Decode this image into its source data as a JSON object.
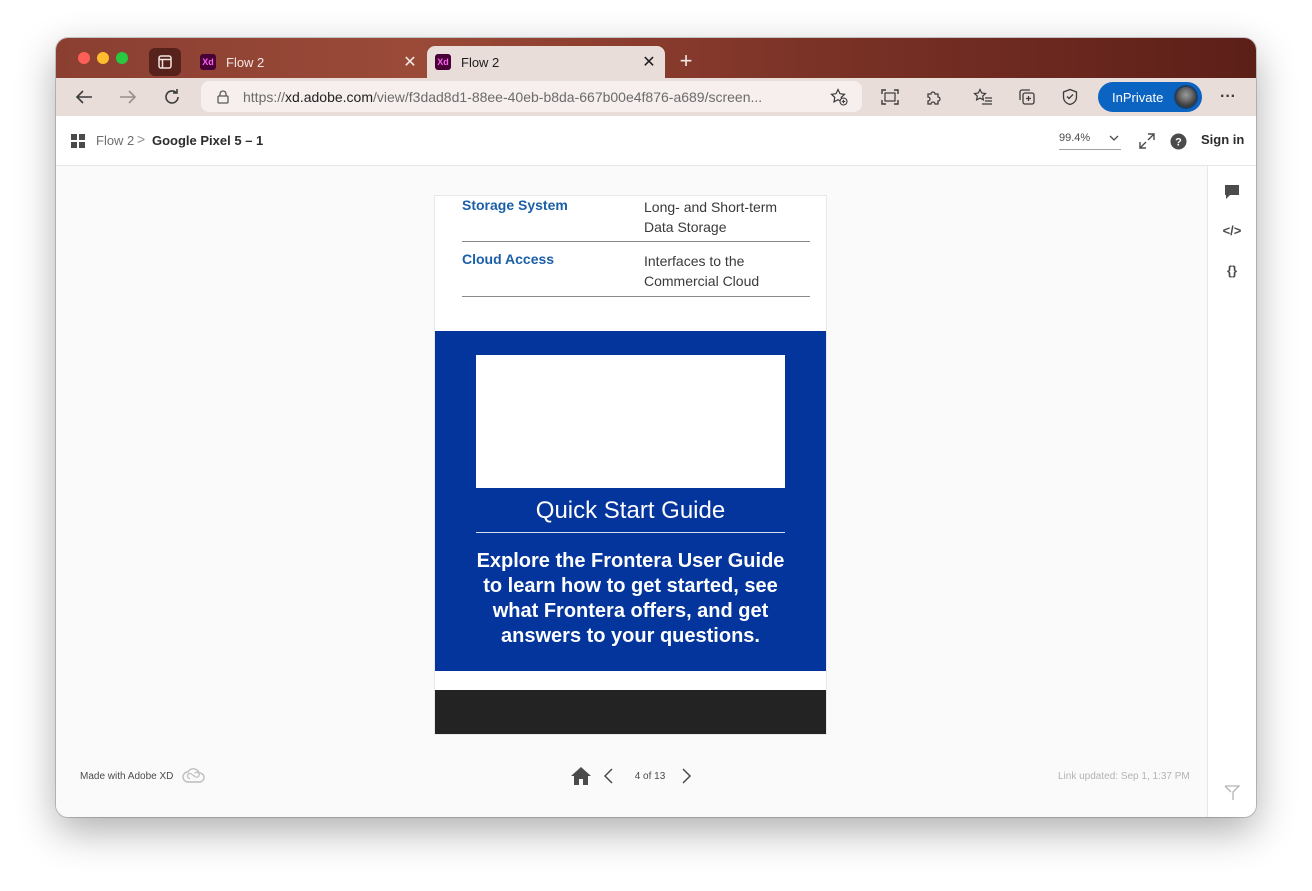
{
  "browser": {
    "tabs": [
      {
        "title": "Flow 2",
        "icon": "adobe-xd-icon",
        "active": false
      },
      {
        "title": "Flow 2",
        "icon": "adobe-xd-icon",
        "active": true
      }
    ],
    "url_prefix": "https://",
    "url_domain": "xd.adobe.com",
    "url_path": "/view/f3dad8d1-88ee-40eb-b8da-667b00e4f876-a689/screen...",
    "inprivate_label": "InPrivate",
    "more_label": "···"
  },
  "header": {
    "breadcrumb_root": "Flow 2",
    "breadcrumb_sep": ">",
    "breadcrumb_current": "Google Pixel 5 – 1",
    "zoom": "99.4%",
    "signin_label": "Sign in"
  },
  "artboard": {
    "rows": [
      {
        "key": "Storage System",
        "value": "Long- and Short-term Data Storage"
      },
      {
        "key": "Cloud Access",
        "value": "Interfaces to the Commercial Cloud"
      }
    ],
    "panel": {
      "title": "Quick Start Guide",
      "body": "Explore the Frontera User Guide to learn how to get started, see what Frontera offers, and get answers to your questions.",
      "color": "#04359c"
    }
  },
  "rail": {
    "code_label": "</>",
    "variables_label": "{}"
  },
  "footer": {
    "made_with": "Made with Adobe XD",
    "page_indicator": "4 of 13",
    "link_updated": "Link updated: Sep 1, 1:37 PM"
  },
  "colors": {
    "inprivate": "#0b63c2",
    "link_blue": "#1b5fa8"
  }
}
